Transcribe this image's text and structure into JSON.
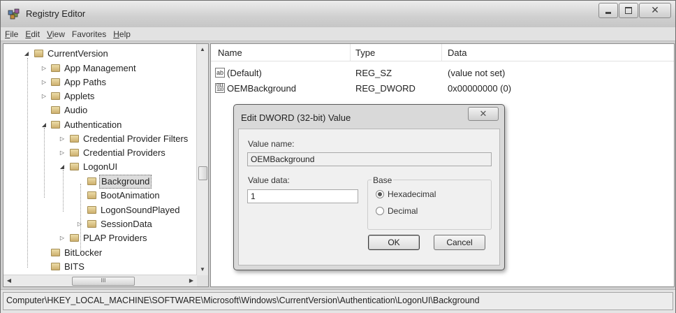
{
  "window": {
    "title": "Registry Editor"
  },
  "menu": [
    {
      "ul": "F",
      "rest": "ile"
    },
    {
      "ul": "E",
      "rest": "dit"
    },
    {
      "ul": "V",
      "rest": "iew"
    },
    {
      "ul": "",
      "rest": "Favorites"
    },
    {
      "ul": "H",
      "rest": "elp"
    }
  ],
  "tree": {
    "nodes": [
      {
        "label": "CurrentVersion",
        "expander": "◢"
      },
      {
        "label": "App Management",
        "expander": "▷"
      },
      {
        "label": "App Paths",
        "expander": "▷"
      },
      {
        "label": "Applets",
        "expander": "▷"
      },
      {
        "label": "Audio",
        "expander": ""
      },
      {
        "label": "Authentication",
        "expander": "◢"
      },
      {
        "label": "Credential Provider Filters",
        "expander": "▷"
      },
      {
        "label": "Credential Providers",
        "expander": "▷"
      },
      {
        "label": "LogonUI",
        "expander": "◢"
      },
      {
        "label": "Background",
        "expander": ""
      },
      {
        "label": "BootAnimation",
        "expander": ""
      },
      {
        "label": "LogonSoundPlayed",
        "expander": ""
      },
      {
        "label": "SessionData",
        "expander": "▷"
      },
      {
        "label": "PLAP Providers",
        "expander": "▷"
      },
      {
        "label": "BitLocker",
        "expander": ""
      },
      {
        "label": "BITS",
        "expander": ""
      }
    ],
    "hscroll_grip": "III"
  },
  "list": {
    "columns": [
      "Name",
      "Type",
      "Data"
    ],
    "rows": [
      {
        "icon": "ab",
        "name": "(Default)",
        "type": "REG_SZ",
        "data": "(value not set)"
      },
      {
        "icon": "011 110",
        "name": "OEMBackground",
        "type": "REG_DWORD",
        "data": "0x00000000 (0)"
      }
    ]
  },
  "dialog": {
    "title": "Edit DWORD (32-bit) Value",
    "close_glyph": "✕",
    "value_name_label": "Value name:",
    "value_name": "OEMBackground",
    "value_data_label": "Value data:",
    "value_data": "1",
    "base_label": "Base",
    "hex_label": "Hexadecimal",
    "dec_label": "Decimal",
    "selected_base": "Hexadecimal",
    "ok_label": "OK",
    "cancel_label": "Cancel"
  },
  "status": {
    "path": "Computer\\HKEY_LOCAL_MACHINE\\SOFTWARE\\Microsoft\\Windows\\CurrentVersion\\Authentication\\LogonUI\\Background"
  }
}
